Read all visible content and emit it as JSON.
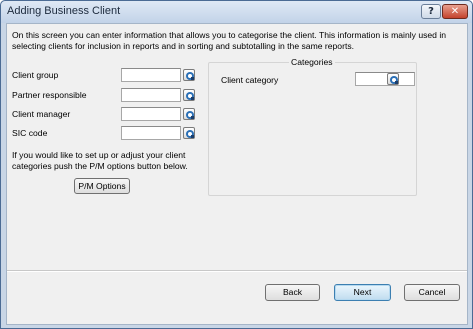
{
  "window": {
    "title": "Adding Business Client",
    "help_label": "?",
    "close_label": "✕"
  },
  "intro_text": "On this screen you can enter information that allows you to categorise the client. This information is mainly used in selecting clients for inclusion in reports and in sorting and subtotalling in the same reports.",
  "fields": [
    {
      "label": "Client group",
      "value": ""
    },
    {
      "label": "Partner responsible",
      "value": ""
    },
    {
      "label": "Client manager",
      "value": ""
    },
    {
      "label": "SIC code",
      "value": ""
    }
  ],
  "help_text": "If you would like to set up or adjust your client categories push the P/M options button below.",
  "pm_button_label": "P/M Options",
  "categories": {
    "group_title": "Categories",
    "field_label": "Client category",
    "field_value": ""
  },
  "footer": {
    "back_label": "Back",
    "next_label": "Next",
    "cancel_label": "Cancel"
  },
  "icons": {
    "lookup": "lookup-icon"
  }
}
